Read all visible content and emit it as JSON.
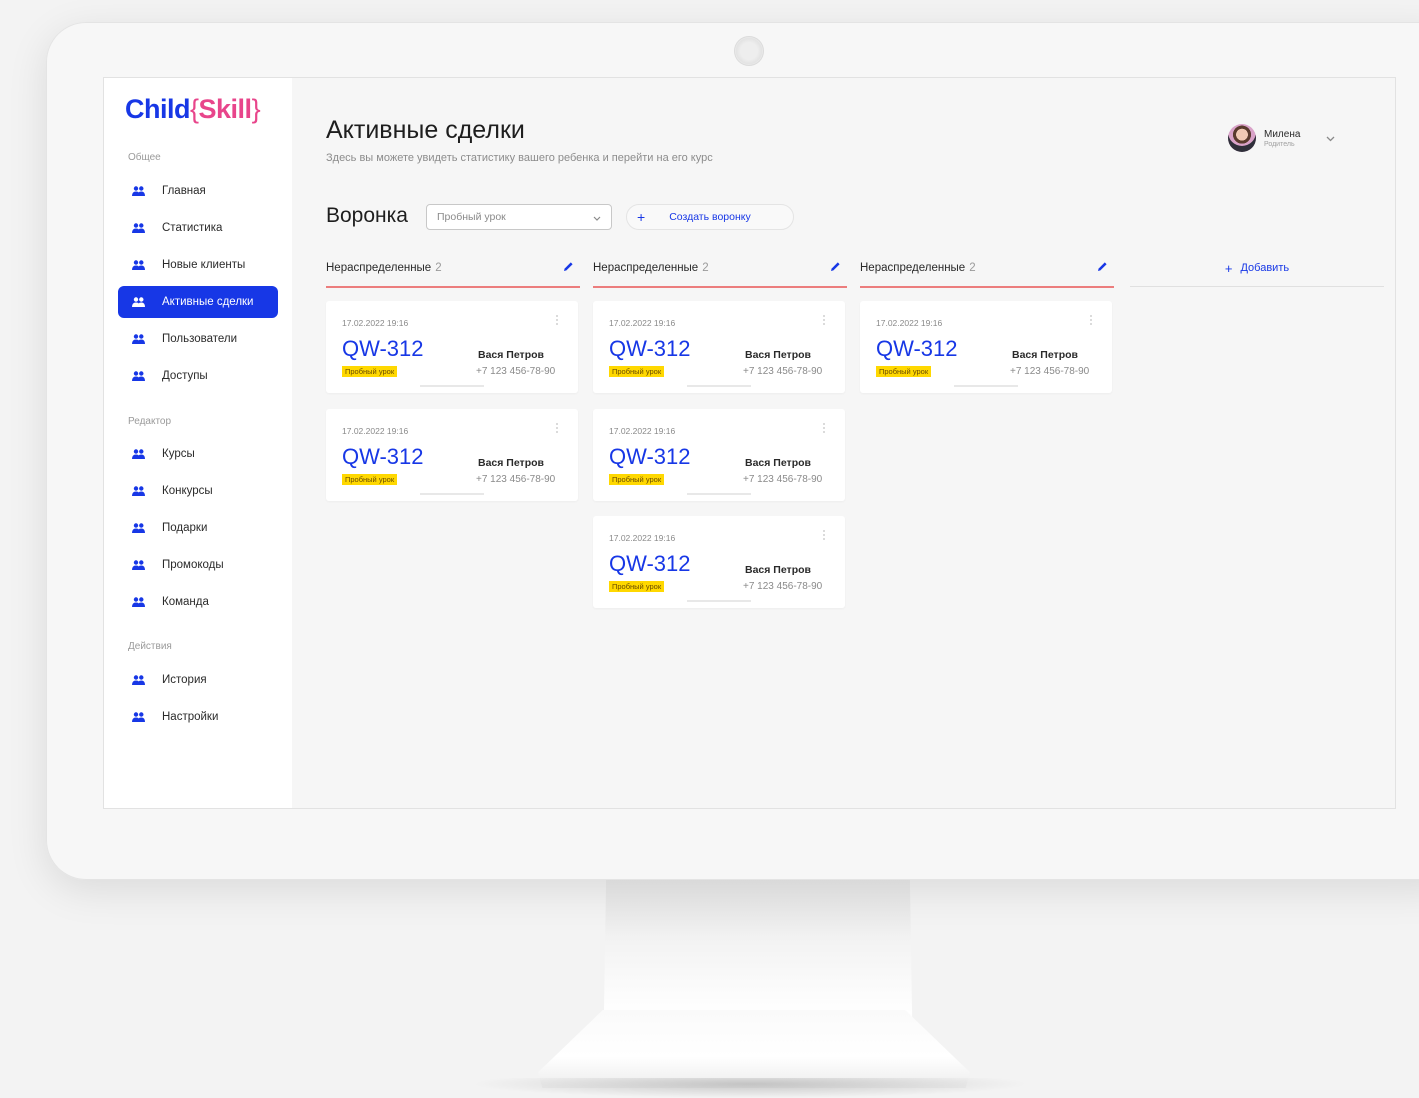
{
  "logo": {
    "child": "Child",
    "open_brace": "{",
    "skill": "Skill",
    "close_brace": "}"
  },
  "sidebar": {
    "sections": [
      "Общее",
      "Редактор",
      "Действия"
    ],
    "items": [
      {
        "label": "Главная"
      },
      {
        "label": "Статистика"
      },
      {
        "label": "Новые клиенты"
      },
      {
        "label": "Активные сделки",
        "active": true
      },
      {
        "label": "Пользователи"
      },
      {
        "label": "Доступы"
      },
      {
        "label": "Курсы"
      },
      {
        "label": "Конкурсы"
      },
      {
        "label": "Подарки"
      },
      {
        "label": "Промокоды"
      },
      {
        "label": "Команда"
      },
      {
        "label": "История"
      },
      {
        "label": "Настройки"
      }
    ]
  },
  "header": {
    "title": "Активные сделки",
    "subtitle": "Здесь вы можете увидеть статистику вашего ребенка и перейти на его курс"
  },
  "user": {
    "name": "Милена",
    "role": "Родитель"
  },
  "funnel": {
    "title": "Воронка",
    "select_value": "Пробный урок",
    "create_label": "Создать воронку",
    "plus": "+"
  },
  "columns": [
    {
      "title": "Нераспределенные",
      "count": "2"
    },
    {
      "title": "Нераспределенные",
      "count": "2"
    },
    {
      "title": "Нераспределенные",
      "count": "2"
    }
  ],
  "add_column": {
    "plus": "+",
    "label": "Добавить"
  },
  "card": {
    "date": "17.02.2022 19:16",
    "code": "QW-312",
    "tag": "Пробный урок",
    "name": "Вася Петров",
    "phone": "+7 123 456-78-90"
  },
  "colors": {
    "accent": "#1737e6",
    "brand_pink": "#e8458b",
    "tag_yellow": "#ffd800",
    "column_line": "#ec7d7d"
  },
  "icons": {
    "nav": "users-icon",
    "edit": "pencil-icon",
    "menu": "dots-vertical-icon",
    "dropdown": "chevron-down-icon"
  }
}
